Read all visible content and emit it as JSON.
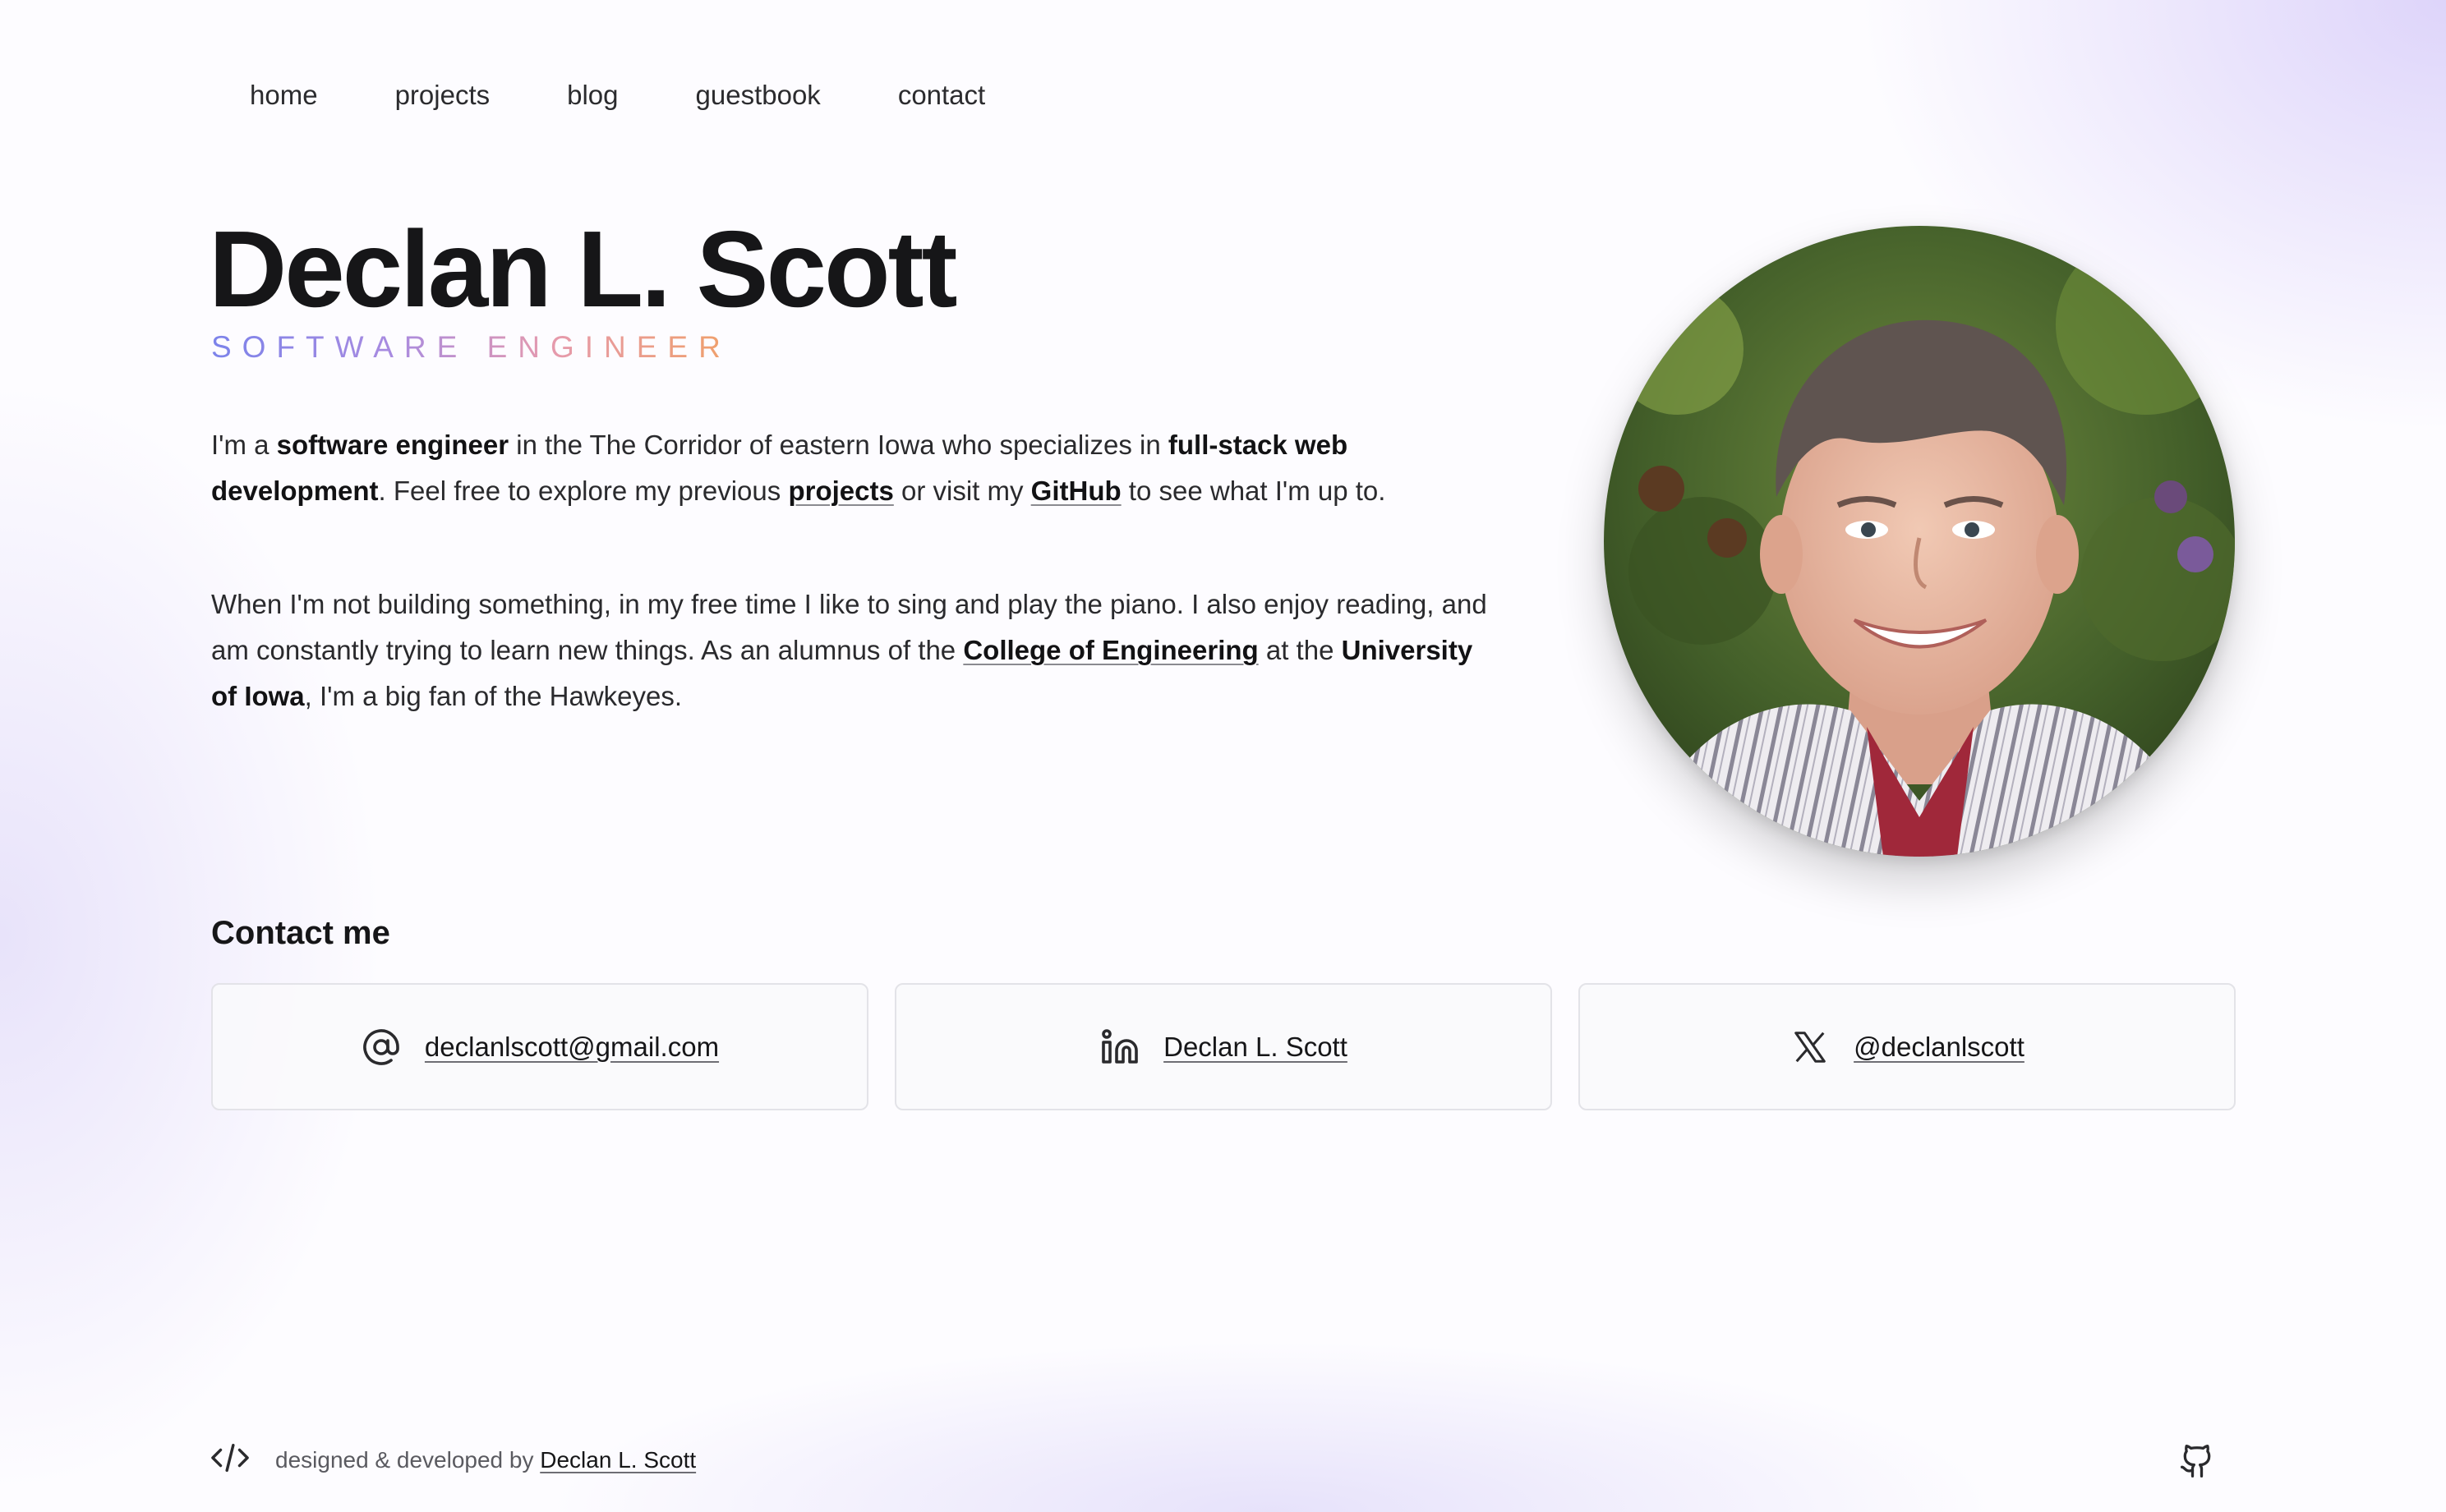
{
  "nav": {
    "items": [
      {
        "label": "home"
      },
      {
        "label": "projects"
      },
      {
        "label": "blog"
      },
      {
        "label": "guestbook"
      },
      {
        "label": "contact"
      }
    ]
  },
  "hero": {
    "name": "Declan L. Scott",
    "role": "SOFTWARE ENGINEER",
    "bio1": {
      "t1": "I'm a ",
      "b1": "software engineer",
      "t2": " in the The Corridor of eastern Iowa who specializes in ",
      "b2": "full-stack web development",
      "t3": ". Feel free to explore my previous ",
      "link1": "projects",
      "t4": " or visit my ",
      "link2": "GitHub",
      "t5": " to see what I'm up to."
    },
    "bio2": {
      "t1": "When I'm not building something, in my free time I like to sing and play the piano. I also enjoy reading, and am constantly trying to learn new things. As an alumnus of the ",
      "link1": "College of Engineering",
      "t2": " at the ",
      "b1": "University of Iowa",
      "t3": ", I'm a big fan of the Hawkeyes."
    },
    "photo_alt": "Declan L. Scott"
  },
  "contact": {
    "heading": "Contact me",
    "cards": [
      {
        "icon": "at-sign-icon",
        "label": "declanlscott@gmail.com"
      },
      {
        "icon": "linkedin-icon",
        "label": "Declan L. Scott"
      },
      {
        "icon": "x-logo-icon",
        "label": "@declanlscott"
      }
    ]
  },
  "footer": {
    "icon": "code-icon",
    "text": "designed & developed by ",
    "link": "Declan L. Scott",
    "github_icon": "github-icon"
  },
  "colors": {
    "role_gradient": [
      "#7c83ea",
      "#a98be0",
      "#e59aae",
      "#f0a06a"
    ],
    "text": "#1c1c1e",
    "background_tint": "#c4b4f6"
  }
}
